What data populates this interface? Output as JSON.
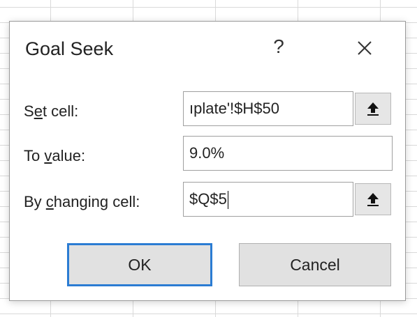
{
  "dialog": {
    "title": "Goal Seek",
    "help_glyph": "?",
    "close_icon": "close-icon"
  },
  "set_cell": {
    "label_prefix": "S",
    "label_accel": "e",
    "label_suffix": "t cell:",
    "value": "ıplate'!$H$50",
    "collapse_icon": "collapse-arrow-icon"
  },
  "to_value": {
    "label_prefix": "To ",
    "label_accel": "v",
    "label_suffix": "alue:",
    "value": "9.0%"
  },
  "by_changing": {
    "label_prefix": "By ",
    "label_accel": "c",
    "label_suffix": "hanging cell:",
    "value": "$Q$5",
    "collapse_icon": "collapse-arrow-icon"
  },
  "buttons": {
    "ok_label": "OK",
    "cancel_label": "Cancel"
  },
  "colors": {
    "default_button_border": "#2b7cd3",
    "button_face": "#e1e1e1"
  }
}
